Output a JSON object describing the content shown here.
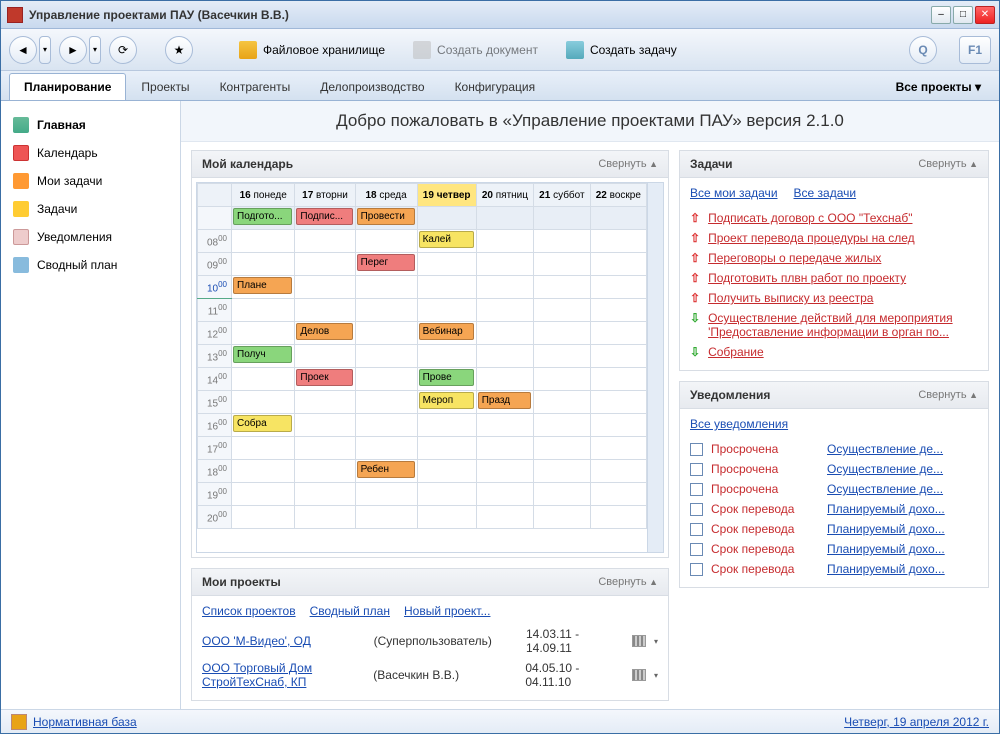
{
  "window": {
    "title": "Управление проектами ПАУ (Васечкин В.В.)"
  },
  "toolbar": {
    "file_storage": "Файловое хранилище",
    "create_doc": "Создать документ",
    "create_task": "Создать задачу"
  },
  "tabs": {
    "planning": "Планирование",
    "projects": "Проекты",
    "contractors": "Контрагенты",
    "docflow": "Делопроизводство",
    "config": "Конфигурация",
    "all_projects": "Все проекты"
  },
  "sidebar": {
    "home": "Главная",
    "calendar": "Календарь",
    "my_tasks": "Мои задачи",
    "tasks": "Задачи",
    "notifications": "Уведомления",
    "summary": "Сводный план"
  },
  "greeting": "Добро пожаловать в «Управление проектами ПАУ» версия 2.1.0",
  "collapse_label": "Свернуть",
  "calendar_panel": {
    "title": "Мой календарь",
    "days": [
      {
        "num": "16",
        "name": "понеде"
      },
      {
        "num": "17",
        "name": "вторни"
      },
      {
        "num": "18",
        "name": "среда"
      },
      {
        "num": "19",
        "name": "четвер"
      },
      {
        "num": "20",
        "name": "пятниц"
      },
      {
        "num": "21",
        "name": "суббот"
      },
      {
        "num": "22",
        "name": "воскре"
      }
    ],
    "allday": {
      "d16": "Подгото...",
      "d17": "Подпис...",
      "d18": "Провести"
    },
    "events": {
      "h08d19": "Калей",
      "h09d18": "Перег",
      "h10d16": "Плане",
      "h12d17": "Делов",
      "h12d19": "Вебинар",
      "h13d16": "Получ",
      "h14d17": "Проек",
      "h14d19": "Прове",
      "h15d19": "Мероп",
      "h15d20": "Празд",
      "h16d16": "Собра",
      "h18d18": "Ребен"
    }
  },
  "projects_panel": {
    "title": "Мои проекты",
    "list_link": "Список проектов",
    "summary_link": "Сводный план",
    "new_link": "Новый проект...",
    "rows": [
      {
        "name": "ООО 'М-Видео', ОД",
        "owner": "(Суперпользователь)",
        "dates": "14.03.11 - 14.09.11"
      },
      {
        "name": "ООО Торговый Дом СтройТехСнаб, КП",
        "owner": "(Васечкин В.В.)",
        "dates": "04.05.10 - 04.11.10"
      }
    ]
  },
  "tasks_panel": {
    "title": "Задачи",
    "all_my": "Все мои задачи",
    "all": "Все задачи",
    "items": [
      {
        "dir": "up",
        "text": "Подписать договор с ООО \"Техснаб\""
      },
      {
        "dir": "up",
        "text": "Проект перевода процедуры на след"
      },
      {
        "dir": "up",
        "text": "Переговоры о передаче жилых"
      },
      {
        "dir": "up",
        "text": "Подготовить плвн работ по проекту"
      },
      {
        "dir": "up",
        "text": "Получить выписку из реестра"
      },
      {
        "dir": "down",
        "text": "Осуществление действий для мероприятия 'Предоставление информации в орган по..."
      },
      {
        "dir": "down",
        "text": "Собрание"
      }
    ]
  },
  "notif_panel": {
    "title": "Уведомления",
    "all_link": "Все уведомления",
    "items": [
      {
        "status": "Просрочена",
        "link": "Осуществление де..."
      },
      {
        "status": "Просрочена",
        "link": "Осуществление де..."
      },
      {
        "status": "Просрочена",
        "link": "Осуществление де..."
      },
      {
        "status": "Срок перевода",
        "link": "Планируемый дохо..."
      },
      {
        "status": "Срок перевода",
        "link": "Планируемый дохо..."
      },
      {
        "status": "Срок перевода",
        "link": "Планируемый дохо..."
      },
      {
        "status": "Срок перевода",
        "link": "Планируемый дохо..."
      }
    ]
  },
  "statusbar": {
    "left": "Нормативная база",
    "right": "Четверг, 19 апреля 2012 г."
  }
}
